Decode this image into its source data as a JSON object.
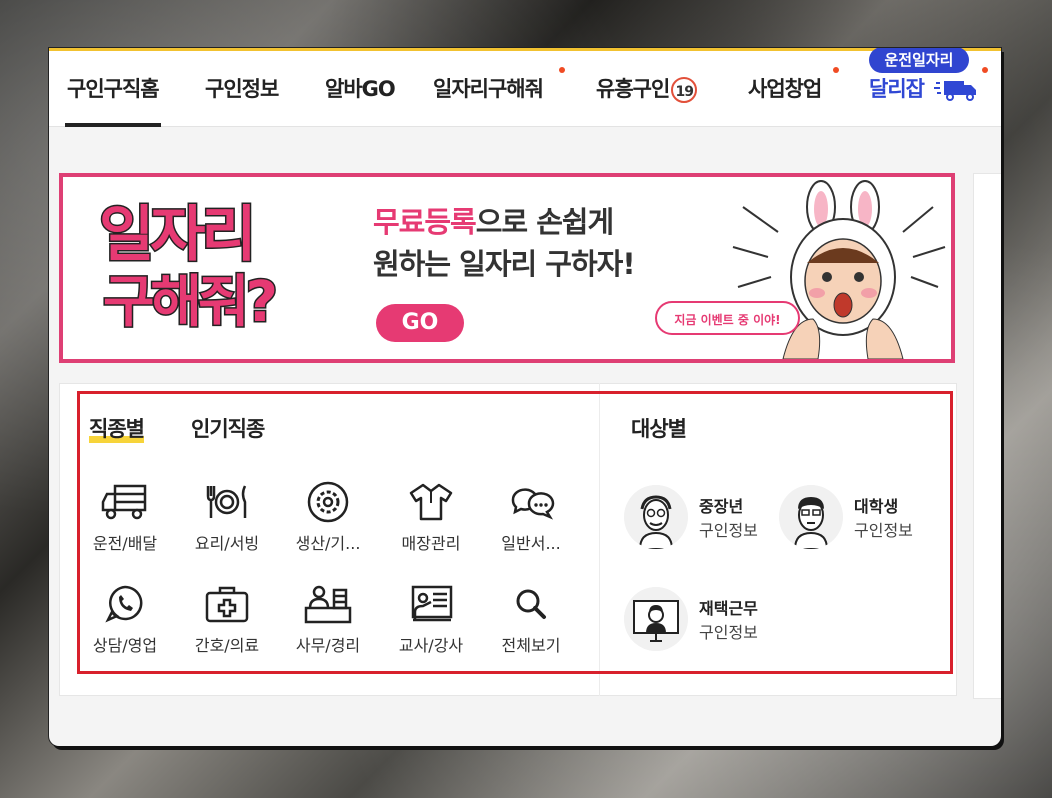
{
  "nav": {
    "items": [
      "구인구직홈",
      "구인정보",
      "알바GO",
      "일자리구해줘",
      "유흥구인",
      "사업창업",
      "달리잡"
    ],
    "age_badge": "19",
    "driver_pill": "운전일자리"
  },
  "banner": {
    "title_line1": "일자리",
    "title_line2": "구해줘?",
    "headline_highlight": "무료등록",
    "headline_rest": "으로 손쉽게",
    "headline_line2": "원하는 일자리 구하자!",
    "go_label": "GO",
    "bubble_text": "지금 이벤트 중 이야!"
  },
  "jobs": {
    "tabs": [
      "직종별",
      "인기직종"
    ],
    "categories": [
      {
        "label": "운전/배달",
        "icon": "truck-icon"
      },
      {
        "label": "요리/서빙",
        "icon": "dining-icon"
      },
      {
        "label": "생산/기...",
        "icon": "gear-icon"
      },
      {
        "label": "매장관리",
        "icon": "shirt-icon"
      },
      {
        "label": "일반서...",
        "icon": "chat-icon"
      },
      {
        "label": "상담/영업",
        "icon": "phone-icon"
      },
      {
        "label": "간호/의료",
        "icon": "medkit-icon"
      },
      {
        "label": "사무/경리",
        "icon": "office-icon"
      },
      {
        "label": "교사/강사",
        "icon": "teacher-icon"
      },
      {
        "label": "전체보기",
        "icon": "search-icon"
      }
    ]
  },
  "targets": {
    "title": "대상별",
    "items": [
      {
        "name": "중장년",
        "sub": "구인정보"
      },
      {
        "name": "대학생",
        "sub": "구인정보"
      },
      {
        "name": "재택근무",
        "sub": "구인정보"
      }
    ]
  }
}
